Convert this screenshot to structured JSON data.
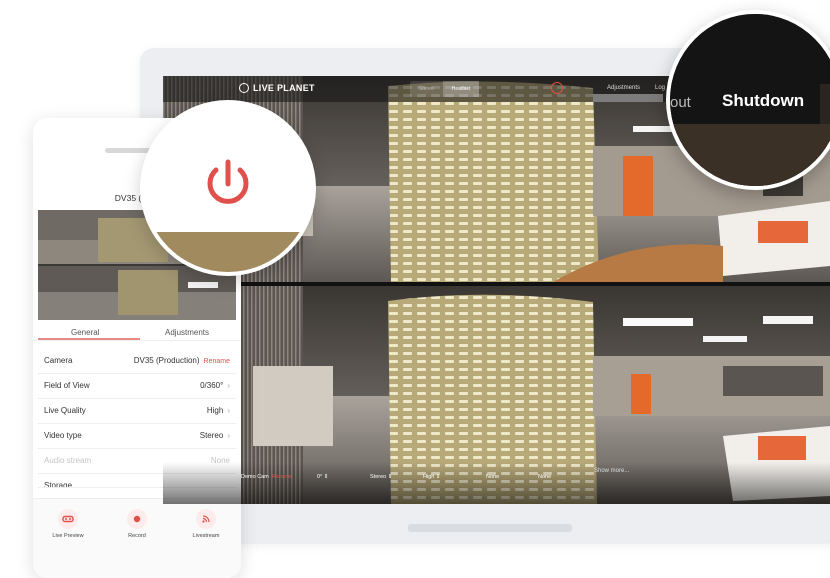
{
  "brand": {
    "name": "LIVE PLANET"
  },
  "topbar": {
    "segments": [
      "Stereo",
      "Headset"
    ],
    "adjustments_label": "Adjustments",
    "logout_label": "Log",
    "accent": "#e0504c"
  },
  "camera_settings": {
    "camera_value": "Demo Cam",
    "rename": "Rename",
    "fov_value": "0° ⇕",
    "type_value": "Stereo ⇕",
    "quality_value": "High ⇕",
    "audio_value": "None",
    "storage_value": "None",
    "show_more": "Show more..."
  },
  "zoom_shutdown": {
    "partial_text": "out",
    "label": "Shutdown"
  },
  "phone": {
    "title": "DV35 (Prod",
    "tabs": [
      "General",
      "Adjustments"
    ],
    "rows": [
      {
        "key": "Camera",
        "value": "DV35 (Production)",
        "extra": "Rename"
      },
      {
        "key": "Field of View",
        "value": "0/360°"
      },
      {
        "key": "Live Quality",
        "value": "High"
      },
      {
        "key": "Video type",
        "value": "Stereo"
      },
      {
        "key": "Audio stream",
        "value": "None"
      },
      {
        "key": "Storage",
        "value": ""
      }
    ],
    "buttons": [
      {
        "label": "Live Preview",
        "icon": "vr-headset-icon"
      },
      {
        "label": "Record",
        "icon": "record-dot-icon"
      },
      {
        "label": "Livestream",
        "icon": "livestream-icon"
      }
    ]
  },
  "icons": {
    "power": "power-icon",
    "chevron": "›"
  }
}
